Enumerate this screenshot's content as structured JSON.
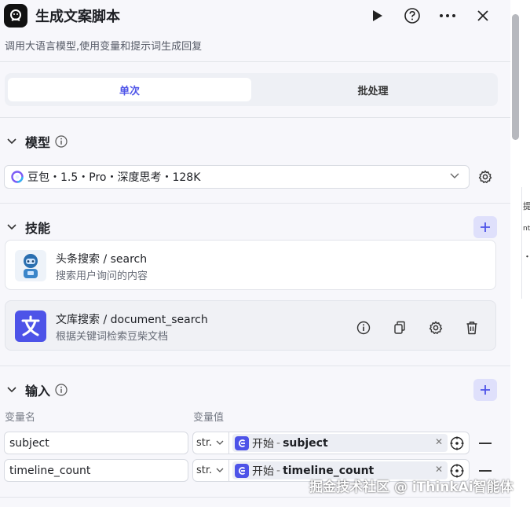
{
  "header": {
    "title": "生成文案脚本",
    "description": "调用大语言模型,使用变量和提示词生成回复"
  },
  "tabs": [
    {
      "label": "单次",
      "active": true
    },
    {
      "label": "批处理",
      "active": false
    }
  ],
  "model_section": {
    "title": "模型",
    "selected_model": "豆包・1.5・Pro・深度思考・128K"
  },
  "skills_section": {
    "title": "技能",
    "items": [
      {
        "name": "头条搜索 / search",
        "description": "搜索用户询问的内容"
      },
      {
        "name": "文库搜索 / document_search",
        "description": "根据关键词检索豆柴文档"
      }
    ]
  },
  "input_section": {
    "title": "输入",
    "col_name": "变量名",
    "col_value": "变量值",
    "rows": [
      {
        "name": "subject",
        "type": "str.",
        "node": "开始",
        "sep": "-",
        "variable": "subject"
      },
      {
        "name": "timeline_count",
        "type": "str.",
        "node": "开始",
        "sep": "-",
        "variable": "timeline_count"
      }
    ]
  },
  "side_strip": {
    "line1": "提",
    "line2": "nt",
    "line3": "・"
  },
  "watermark": "掘金技术社区 @ iThinkAi智能体",
  "colors": {
    "accent": "#4d53e8",
    "accent_soft": "#dfe0fb",
    "panel_bg": "#f7f7fb"
  }
}
